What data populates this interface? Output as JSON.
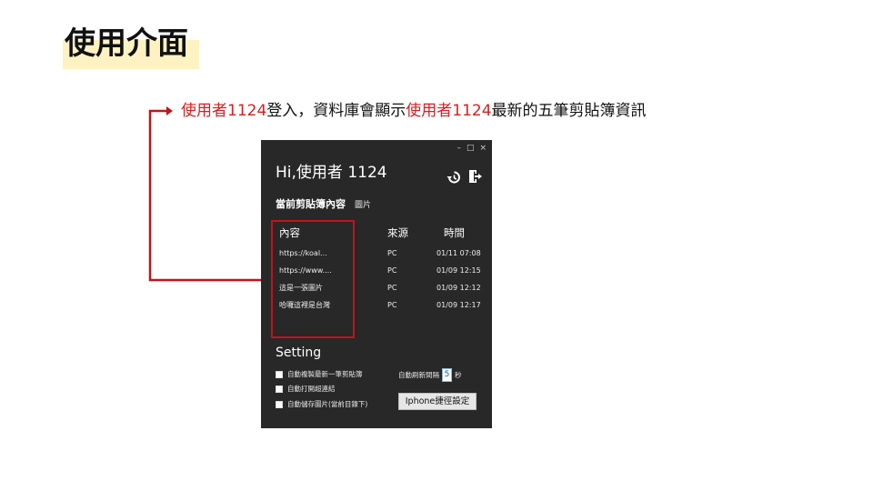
{
  "slide": {
    "title": "使用介面",
    "caption": {
      "part1": "使用者1124",
      "part2": "登入，資料庫會顯示",
      "part3": "使用者1124",
      "part4": "最新的五筆剪貼簿資訊"
    }
  },
  "app": {
    "window_controls": {
      "minimize": "–",
      "maximize": "□",
      "close": "×"
    },
    "greeting": "Hi,使用者 1124",
    "icons": {
      "history": "history-icon",
      "logout": "logout-icon"
    },
    "current_clip": {
      "label": "當前剪貼簿內容",
      "value": "圖片"
    },
    "table": {
      "headers": {
        "content": "內容",
        "source": "來源",
        "time": "時間"
      },
      "rows": [
        {
          "content": "https://koal...",
          "source": "PC",
          "time": "01/11 07:08"
        },
        {
          "content": "https://www....",
          "source": "PC",
          "time": "01/09 12:15"
        },
        {
          "content": "這是一張圖片",
          "source": "PC",
          "time": "01/09 12:12"
        },
        {
          "content": "哈囉這裡是台灣",
          "source": "PC",
          "time": "01/09 12:17"
        }
      ]
    },
    "settings": {
      "title": "Setting",
      "options": [
        "自動複製最新一筆剪貼簿",
        "自動打開超連結",
        "自動儲存圖片(當前目錄下)"
      ],
      "refresh_label": "自動刷新間隔",
      "refresh_value": "5",
      "refresh_unit": "秒",
      "shortcut_button": "Iphone捷徑設定"
    }
  },
  "colors": {
    "accent_red": "#c0141a",
    "highlight_yellow": "#fff2c2",
    "app_bg": "#282828"
  }
}
